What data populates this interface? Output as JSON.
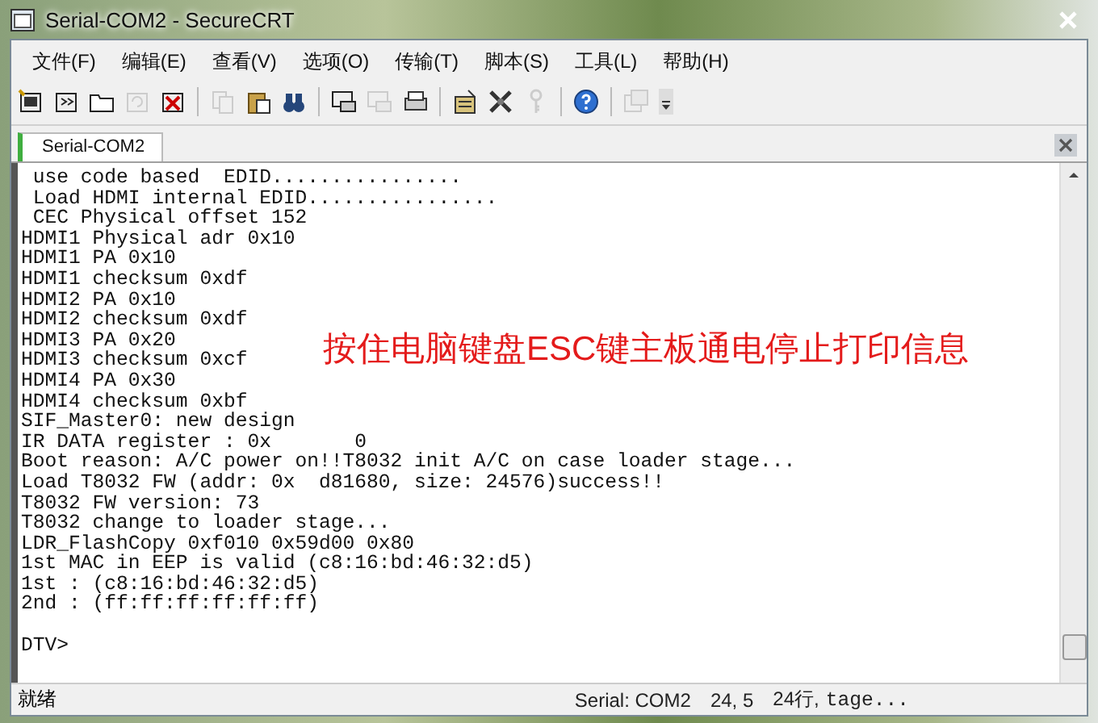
{
  "window": {
    "title": "Serial-COM2 - SecureCRT"
  },
  "menu": [
    "文件(F)",
    "编辑(E)",
    "查看(V)",
    "选项(O)",
    "传输(T)",
    "脚本(S)",
    "工具(L)",
    "帮助(H)"
  ],
  "toolbar": [
    {
      "kind": "connect",
      "disabled": false
    },
    {
      "kind": "quick",
      "disabled": false
    },
    {
      "kind": "folder",
      "disabled": false
    },
    {
      "kind": "reconnect",
      "disabled": true
    },
    {
      "kind": "disconnect",
      "disabled": false
    },
    {
      "kind": "sep"
    },
    {
      "kind": "copy",
      "disabled": true
    },
    {
      "kind": "paste",
      "disabled": false
    },
    {
      "kind": "find",
      "disabled": false
    },
    {
      "kind": "sep"
    },
    {
      "kind": "print",
      "disabled": false
    },
    {
      "kind": "printsel",
      "disabled": true
    },
    {
      "kind": "printer",
      "disabled": false
    },
    {
      "kind": "sep"
    },
    {
      "kind": "options",
      "disabled": false
    },
    {
      "kind": "keymap",
      "disabled": false
    },
    {
      "kind": "key",
      "disabled": true
    },
    {
      "kind": "sep"
    },
    {
      "kind": "help",
      "disabled": false
    },
    {
      "kind": "sep"
    },
    {
      "kind": "window",
      "disabled": true
    },
    {
      "kind": "more",
      "disabled": false
    }
  ],
  "tabs": [
    {
      "label": "Serial-COM2",
      "selected": true
    }
  ],
  "terminal": {
    "lines": [
      " use code based  EDID................",
      " Load HDMI internal EDID................",
      " CEC Physical offset 152",
      "HDMI1 Physical adr 0x10",
      "HDMI1 PA 0x10",
      "HDMI1 checksum 0xdf",
      "HDMI2 PA 0x10",
      "HDMI2 checksum 0xdf",
      "HDMI3 PA 0x20",
      "HDMI3 checksum 0xcf",
      "HDMI4 PA 0x30",
      "HDMI4 checksum 0xbf",
      "SIF_Master0: new design",
      "IR DATA register : 0x       0",
      "Boot reason: A/C power on!!T8032 init A/C on case loader stage...",
      "Load T8032 FW (addr: 0x  d81680, size: 24576)success!!",
      "T8032 FW version: 73",
      "T8032 change to loader stage...",
      "LDR_FlashCopy 0xf010 0x59d00 0x80",
      "1st MAC in EEP is valid (c8:16:bd:46:32:d5)",
      "1st : (c8:16:bd:46:32:d5)",
      "2nd : (ff:ff:ff:ff:ff:ff)"
    ],
    "prompt": "DTV>",
    "annotation": "按住电脑键盘ESC键主板通电停止打印信息"
  },
  "status_bar": {
    "state": "就绪",
    "items": [
      "Serial: COM2",
      "24,  5",
      "24行,",
      "tage..."
    ]
  }
}
